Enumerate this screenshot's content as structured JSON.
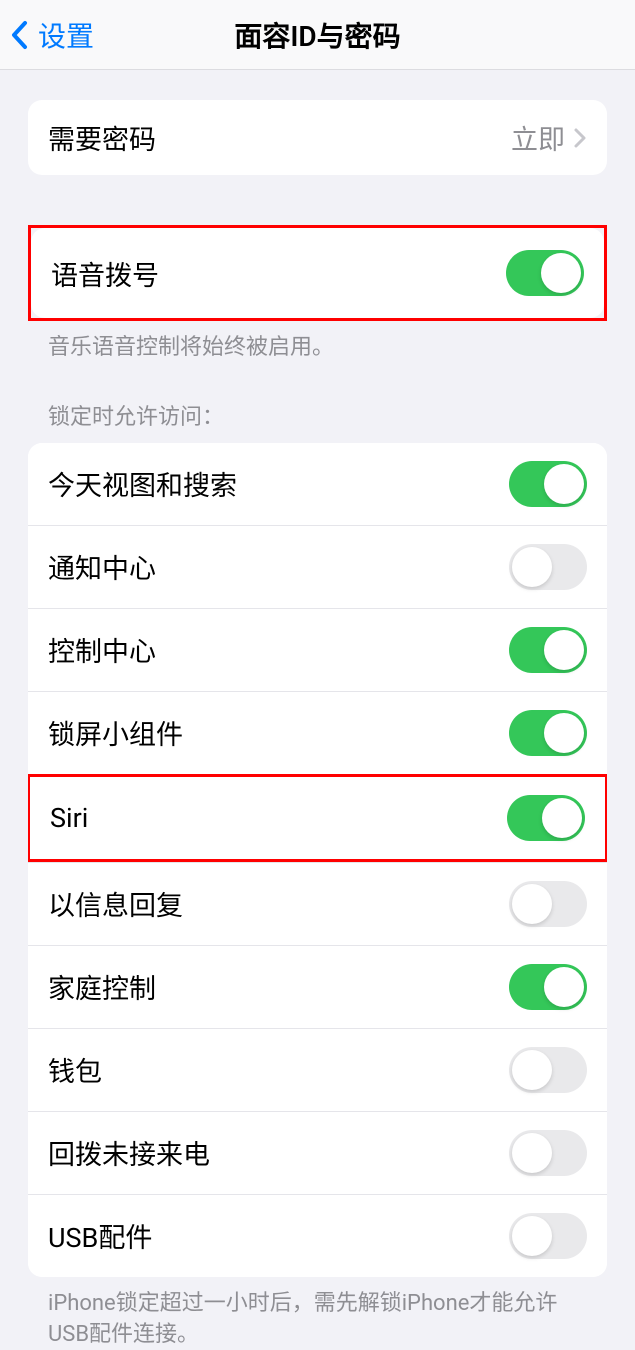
{
  "header": {
    "back_label": "设置",
    "title": "面容ID与密码"
  },
  "passcode_section": {
    "require_passcode_label": "需要密码",
    "require_passcode_value": "立即"
  },
  "voice_dial": {
    "label": "语音拨号",
    "enabled": true,
    "footer": "音乐语音控制将始终被启用。"
  },
  "lock_access": {
    "header": "锁定时允许访问：",
    "items": [
      {
        "label": "今天视图和搜索",
        "enabled": true,
        "name": "today-view"
      },
      {
        "label": "通知中心",
        "enabled": false,
        "name": "notification-center"
      },
      {
        "label": "控制中心",
        "enabled": true,
        "name": "control-center"
      },
      {
        "label": "锁屏小组件",
        "enabled": true,
        "name": "lock-screen-widgets"
      },
      {
        "label": "Siri",
        "enabled": true,
        "name": "siri",
        "highlighted": true
      },
      {
        "label": "以信息回复",
        "enabled": false,
        "name": "reply-with-message"
      },
      {
        "label": "家庭控制",
        "enabled": true,
        "name": "home-control"
      },
      {
        "label": "钱包",
        "enabled": false,
        "name": "wallet"
      },
      {
        "label": "回拨未接来电",
        "enabled": false,
        "name": "return-missed-calls"
      },
      {
        "label": "USB配件",
        "enabled": false,
        "name": "usb-accessories"
      }
    ],
    "footer": "iPhone锁定超过一小时后，需先解锁iPhone才能允许USB配件连接。"
  }
}
